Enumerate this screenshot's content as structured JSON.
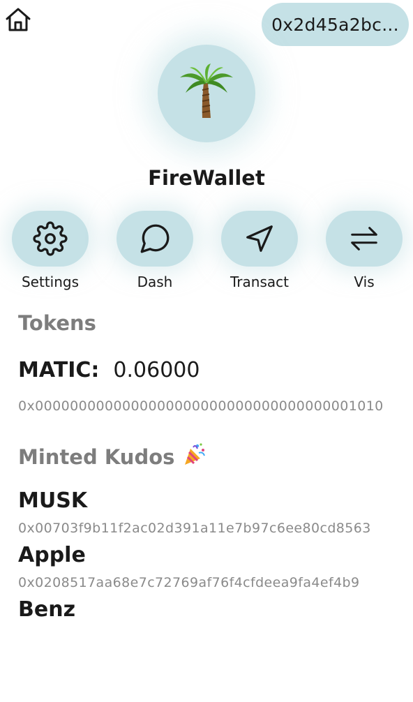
{
  "header": {
    "home_icon": "home-icon",
    "address_short": "0x2d45a2bc..."
  },
  "app": {
    "logo_icon": "palm-tree-icon",
    "title": "FireWallet"
  },
  "actions": [
    {
      "label": "Settings",
      "icon": "gear-icon"
    },
    {
      "label": "Dash",
      "icon": "chat-bubble-icon"
    },
    {
      "label": "Transact",
      "icon": "send-arrow-icon"
    },
    {
      "label": "Vis",
      "icon": "swap-arrows-icon"
    }
  ],
  "tokens": {
    "heading": "Tokens",
    "items": [
      {
        "symbol": "MATIC:",
        "amount": "0.06000",
        "address": "0x0000000000000000000000000000000000001010"
      }
    ]
  },
  "kudos": {
    "heading": "Minted Kudos",
    "heading_icon": "party-popper-icon",
    "items": [
      {
        "name": "MUSK",
        "address": "0x00703f9b11f2ac02d391a11e7b97c6ee80cd8563"
      },
      {
        "name": "Apple",
        "address": "0x0208517aa68e7c72769af76f4cfdeea9fa4ef4b9"
      },
      {
        "name": "Benz",
        "address": ""
      }
    ]
  },
  "colors": {
    "accent_bg": "#c5e1e6",
    "muted_text": "#7d7d7d",
    "address_text": "#8a8a8a"
  }
}
